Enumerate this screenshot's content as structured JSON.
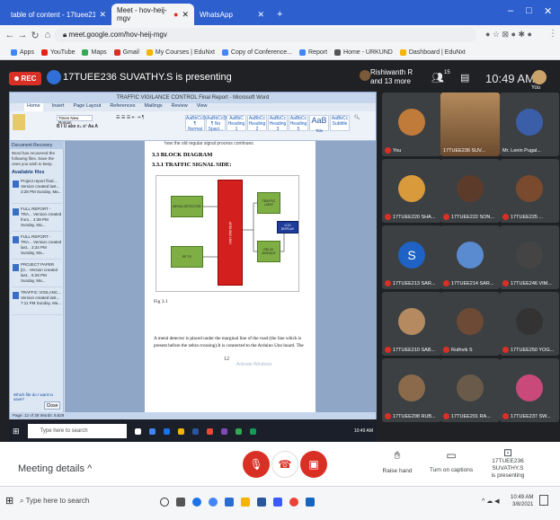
{
  "browser": {
    "tabs": [
      {
        "label": "table of content - 17tuee211@..."
      },
      {
        "label": "Meet - hov-heij-mgv"
      },
      {
        "label": "WhatsApp"
      }
    ],
    "new_tab": "+",
    "url": "meet.google.com/hov-heij-mgv",
    "bookmarks": [
      "Apps",
      "YouTube",
      "Maps",
      "Gmail",
      "My Courses | EduNxt",
      "Copy of Conference...",
      "Report",
      "Home - URKUND",
      "Dashboard | EduNxt"
    ]
  },
  "meet": {
    "rec": "REC",
    "presenting_title": "17TUEE236 SUVATHY.S is presenting",
    "people_line1": "Rishiwanth R",
    "people_line2": "and 13 more",
    "people_count": "15",
    "time": "10:49 AM",
    "you_label": "You",
    "meeting_details": "Meeting details",
    "raise_hand": "Raise hand",
    "captions": "Turn on captions",
    "presenting_line1": "17TUEE236 SUVATHY.S",
    "presenting_line2": "is presenting"
  },
  "word": {
    "title": "TRAFFIC VIGILANCE CONTROL Final Report - Microsoft Word",
    "tabs": [
      "Home",
      "Insert",
      "Page Layout",
      "References",
      "Mailings",
      "Review",
      "View"
    ],
    "styles": [
      "AaBbCcDc",
      "AaBbCcDc",
      "AaBbC",
      "AaBbCc",
      "AaBbCc",
      "AaBbCc",
      "AaB",
      "AaBbCc"
    ],
    "style_names": [
      "¶ Normal",
      "¶ No Spaci...",
      "Heading 1",
      "Heading 2",
      "Heading 3",
      "Heading 5",
      "Title",
      "Subtitle"
    ],
    "font_name": "Times New Roman",
    "nav_pane": {
      "title": "Document Recovery",
      "text": "Word has recovered the following files. Save the ones you wish to keep.",
      "available": "Available files",
      "items": [
        {
          "name": "Project report final.... Version created last... 3:28 PM Sunday, Ma..."
        },
        {
          "name": "FULL REPORT - TRA... Version created from... 4:39 PM Sunday, Ma..."
        },
        {
          "name": "FULL REPORT - TRA... Version created last... 3:34 PM Sunday, Ma..."
        },
        {
          "name": "PROJECT PAPER [O... Version created last... 6:28 PM Sunday, Ma..."
        },
        {
          "name": "TRAFFIC VIGILANC... Version created last... 7:11 PM Sunday, Ma..."
        }
      ],
      "which_file": "Which file do I want to save?",
      "close": "Close"
    },
    "page": {
      "top_line": "how the old regular signal process continues.",
      "h1": "3.3 BLOCK DIAGRAM",
      "h2": "3.3.1 TRAFFIC SIGNAL SIDE:",
      "blocks": {
        "metal": "METAL DETECTOR",
        "rf": "RF TX",
        "arduino": "ARDUINO UNO",
        "traffic": "TRAFFIC LIGHT",
        "relay": "RELAY MODULE",
        "lcd": "LCD DISPLAY"
      },
      "fig": "Fig 3.1",
      "body": "A metal detector is placed under the marginal line of the road (the line which is present before the zebra crossing).It is connected to the Arduino Uno board. The",
      "page_num": "12"
    },
    "status": "Page: 12 of 36   Words: 9,829",
    "watermark": "Activate Windows"
  },
  "inner_taskbar": {
    "search": "Type here to search"
  },
  "participants": [
    {
      "name": "You"
    },
    {
      "name": "17TUEE236 SUV..."
    },
    {
      "name": "Mr. Lenin Pugal..."
    },
    {
      "name": "17TUEE220 SHA..."
    },
    {
      "name": "17TUEE222 SON..."
    },
    {
      "name": "17TUEE225 ..."
    },
    {
      "name": "17TUEE213 SAR..."
    },
    {
      "name": "17TUEE214 SAR..."
    },
    {
      "name": "17TUEE246 VIM..."
    },
    {
      "name": "17TUEE210 SAB..."
    },
    {
      "name": "Ruthvik S"
    },
    {
      "name": "17TUEE250 YOG..."
    },
    {
      "name": "17TUEE208 RUB..."
    },
    {
      "name": "17TUEE201 RA..."
    },
    {
      "name": "17TUEE237 SW..."
    }
  ],
  "participant_initial": "S",
  "taskbar": {
    "search": "Type here to search",
    "time": "10:49 AM",
    "date": "3/8/2021"
  }
}
